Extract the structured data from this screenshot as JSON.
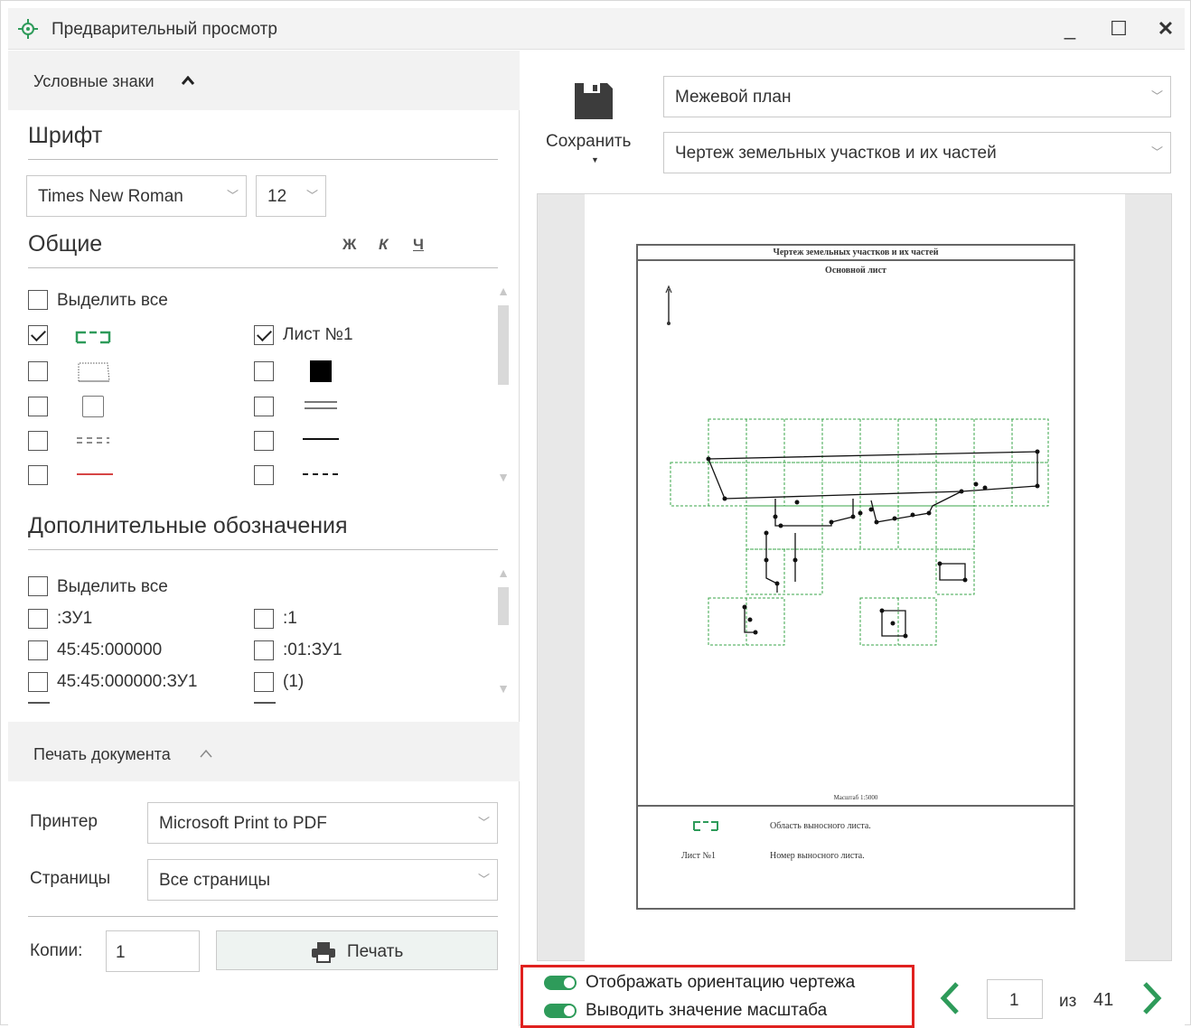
{
  "window": {
    "title": "Предварительный просмотр",
    "minimize": "_",
    "maximize": "☐",
    "close": "✕"
  },
  "legend_section": {
    "header": "Условные знаки",
    "font_heading": "Шрифт",
    "font_family": "Times New Roman",
    "font_size": "12",
    "bold": "Ж",
    "italic": "К",
    "underline": "Ч",
    "general_heading": "Общие",
    "select_all": "Выделить все",
    "sheet_label": "Лист №1",
    "extra_heading": "Дополнительные обозначения",
    "extra_select_all": "Выделить все",
    "extra_items_left": [
      ":ЗУ1",
      "45:45:000000",
      "45:45:000000:ЗУ1"
    ],
    "extra_items_right": [
      ":1",
      ":01:ЗУ1",
      "(1)"
    ]
  },
  "print_section": {
    "header": "Печать документа",
    "printer_label": "Принтер",
    "printer_value": "Microsoft Print to PDF",
    "pages_label": "Страницы",
    "pages_value": "Все страницы",
    "copies_label": "Копии:",
    "copies_value": "1",
    "print_button": "Печать"
  },
  "toolbar": {
    "save_label": "Сохранить",
    "document_type": "Межевой план",
    "document_section": "Чертеж земельных участков и их частей"
  },
  "page_preview": {
    "title": "Чертеж земельных участков и их частей",
    "subtitle": "Основной лист",
    "scale": "Масштаб 1:5000",
    "legend_1_text": "Область выносного листа.",
    "legend_2_symbol": "Лист №1",
    "legend_2_text": "Номер выносного листа."
  },
  "options": {
    "show_orientation": "Отображать ориентацию чертежа",
    "show_scale": "Выводить значение масштаба"
  },
  "pagination": {
    "current_page": "1",
    "of_label": "из",
    "total_pages": "41"
  },
  "colors": {
    "accent_green": "#2e9b5a",
    "highlight_red": "#e0211f"
  }
}
